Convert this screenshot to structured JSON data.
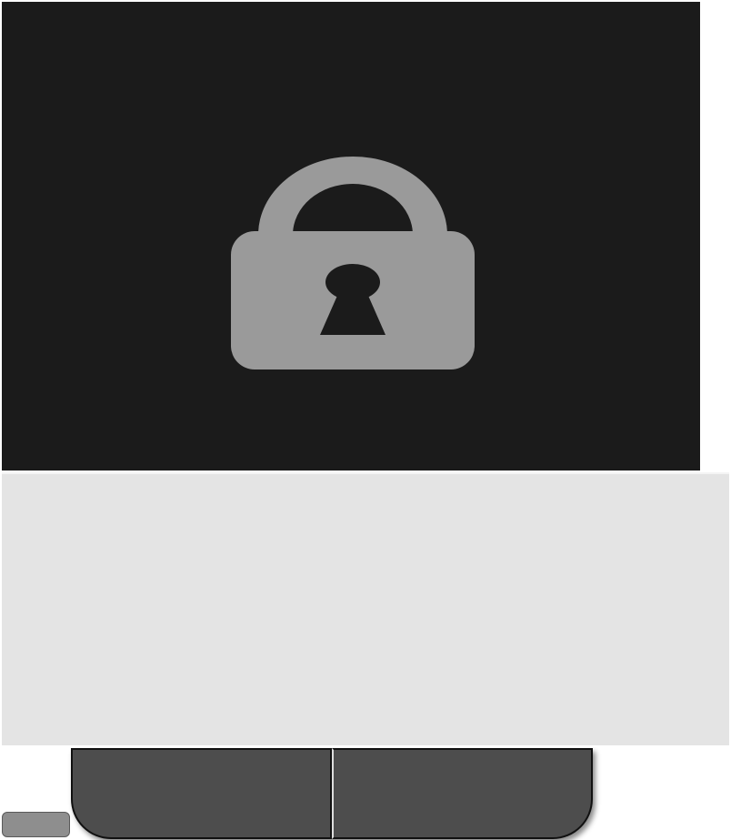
{
  "lock_screen": {
    "icon": "lock-icon",
    "background_color": "#1b1b1b",
    "icon_color": "#9a9a9a"
  },
  "content_area": {
    "background_color": "#e4e4e4"
  },
  "buttons": {
    "left_label": "",
    "right_label": "",
    "color": "#4d4d4d"
  },
  "corner_tab": {
    "label": "",
    "color": "#8e8e8e"
  }
}
